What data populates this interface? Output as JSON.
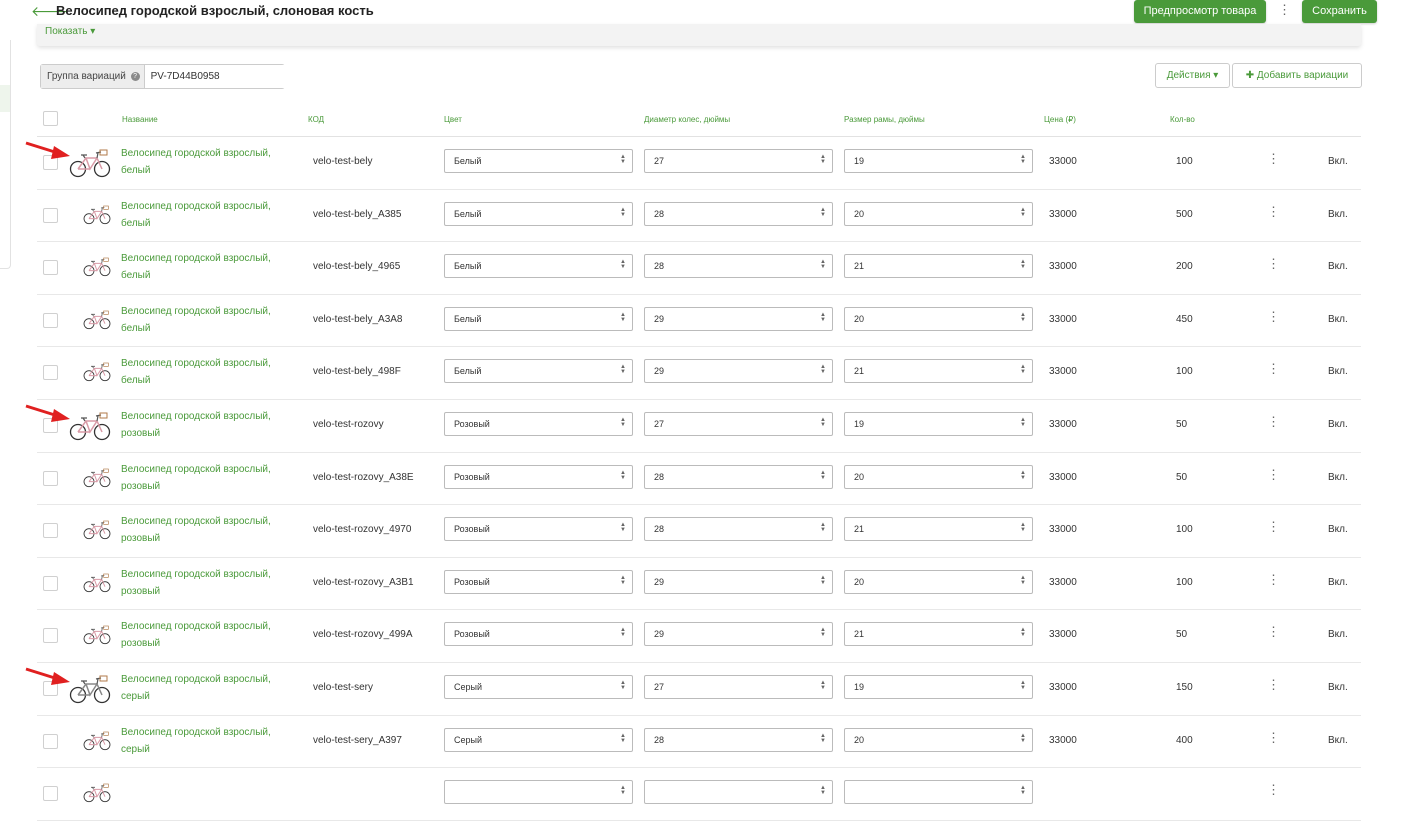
{
  "header": {
    "title": "Велосипед городской взрослый, слоновая кость",
    "preview_label": "Предпросмотр товара",
    "save_label": "Сохранить",
    "more_glyph": "⋮",
    "back_glyph": "🡐"
  },
  "filter": {
    "show_label": "Показать ▾"
  },
  "group": {
    "label": "Группа вариаций",
    "help_glyph": "?",
    "value": "PV-7D44B0958"
  },
  "actions": {
    "actions_label": "Действия ▾",
    "add_label": "✚ Добавить вариации"
  },
  "columns": {
    "name": "Название",
    "code": "КОД",
    "color": "Цвет",
    "wheel": "Диаметр колес, дюймы",
    "frame": "Размер рамы, дюймы",
    "price": "Цена (₽)",
    "qty": "Кол-во"
  },
  "rows": [
    {
      "name": "Велосипед городской взрослый, белый",
      "code": "velo-test-bely",
      "color": "Белый",
      "wheel": "27",
      "frame": "19",
      "price": "33000",
      "qty": "100",
      "status": "Вкл.",
      "bike_color": "white",
      "marked": true
    },
    {
      "name": "Велосипед городской взрослый, белый",
      "code": "velo-test-bely_A385",
      "color": "Белый",
      "wheel": "28",
      "frame": "20",
      "price": "33000",
      "qty": "500",
      "status": "Вкл.",
      "bike_color": "pink",
      "marked": false
    },
    {
      "name": "Велосипед городской взрослый, белый",
      "code": "velo-test-bely_4965",
      "color": "Белый",
      "wheel": "28",
      "frame": "21",
      "price": "33000",
      "qty": "200",
      "status": "Вкл.",
      "bike_color": "pink",
      "marked": false
    },
    {
      "name": "Велосипед городской взрослый, белый",
      "code": "velo-test-bely_A3A8",
      "color": "Белый",
      "wheel": "29",
      "frame": "20",
      "price": "33000",
      "qty": "450",
      "status": "Вкл.",
      "bike_color": "pink",
      "marked": false
    },
    {
      "name": "Велосипед городской взрослый, белый",
      "code": "velo-test-bely_498F",
      "color": "Белый",
      "wheel": "29",
      "frame": "21",
      "price": "33000",
      "qty": "100",
      "status": "Вкл.",
      "bike_color": "pink",
      "marked": false
    },
    {
      "name": "Велосипед городской взрослый, розовый",
      "code": "velo-test-rozovy",
      "color": "Розовый",
      "wheel": "27",
      "frame": "19",
      "price": "33000",
      "qty": "50",
      "status": "Вкл.",
      "bike_color": "pink",
      "marked": true
    },
    {
      "name": "Велосипед городской взрослый, розовый",
      "code": "velo-test-rozovy_A38E",
      "color": "Розовый",
      "wheel": "28",
      "frame": "20",
      "price": "33000",
      "qty": "50",
      "status": "Вкл.",
      "bike_color": "pink",
      "marked": false
    },
    {
      "name": "Велосипед городской взрослый, розовый",
      "code": "velo-test-rozovy_4970",
      "color": "Розовый",
      "wheel": "28",
      "frame": "21",
      "price": "33000",
      "qty": "100",
      "status": "Вкл.",
      "bike_color": "pink",
      "marked": false
    },
    {
      "name": "Велосипед городской взрослый, розовый",
      "code": "velo-test-rozovy_A3B1",
      "color": "Розовый",
      "wheel": "29",
      "frame": "20",
      "price": "33000",
      "qty": "100",
      "status": "Вкл.",
      "bike_color": "pink",
      "marked": false
    },
    {
      "name": "Велосипед городской взрослый, розовый",
      "code": "velo-test-rozovy_499A",
      "color": "Розовый",
      "wheel": "29",
      "frame": "21",
      "price": "33000",
      "qty": "50",
      "status": "Вкл.",
      "bike_color": "pink",
      "marked": false
    },
    {
      "name": "Велосипед городской взрослый, серый",
      "code": "velo-test-sery",
      "color": "Серый",
      "wheel": "27",
      "frame": "19",
      "price": "33000",
      "qty": "150",
      "status": "Вкл.",
      "bike_color": "gray",
      "marked": true
    },
    {
      "name": "Велосипед городской взрослый, серый",
      "code": "velo-test-sery_A397",
      "color": "Серый",
      "wheel": "28",
      "frame": "20",
      "price": "33000",
      "qty": "400",
      "status": "Вкл.",
      "bike_color": "pink",
      "marked": false
    },
    {
      "name": "",
      "code": "",
      "color": "",
      "wheel": "",
      "frame": "",
      "price": "",
      "qty": "",
      "status": "",
      "bike_color": "pink",
      "marked": false
    }
  ],
  "colors": {
    "accent": "#4a9a3a",
    "arrow": "#e02020"
  }
}
